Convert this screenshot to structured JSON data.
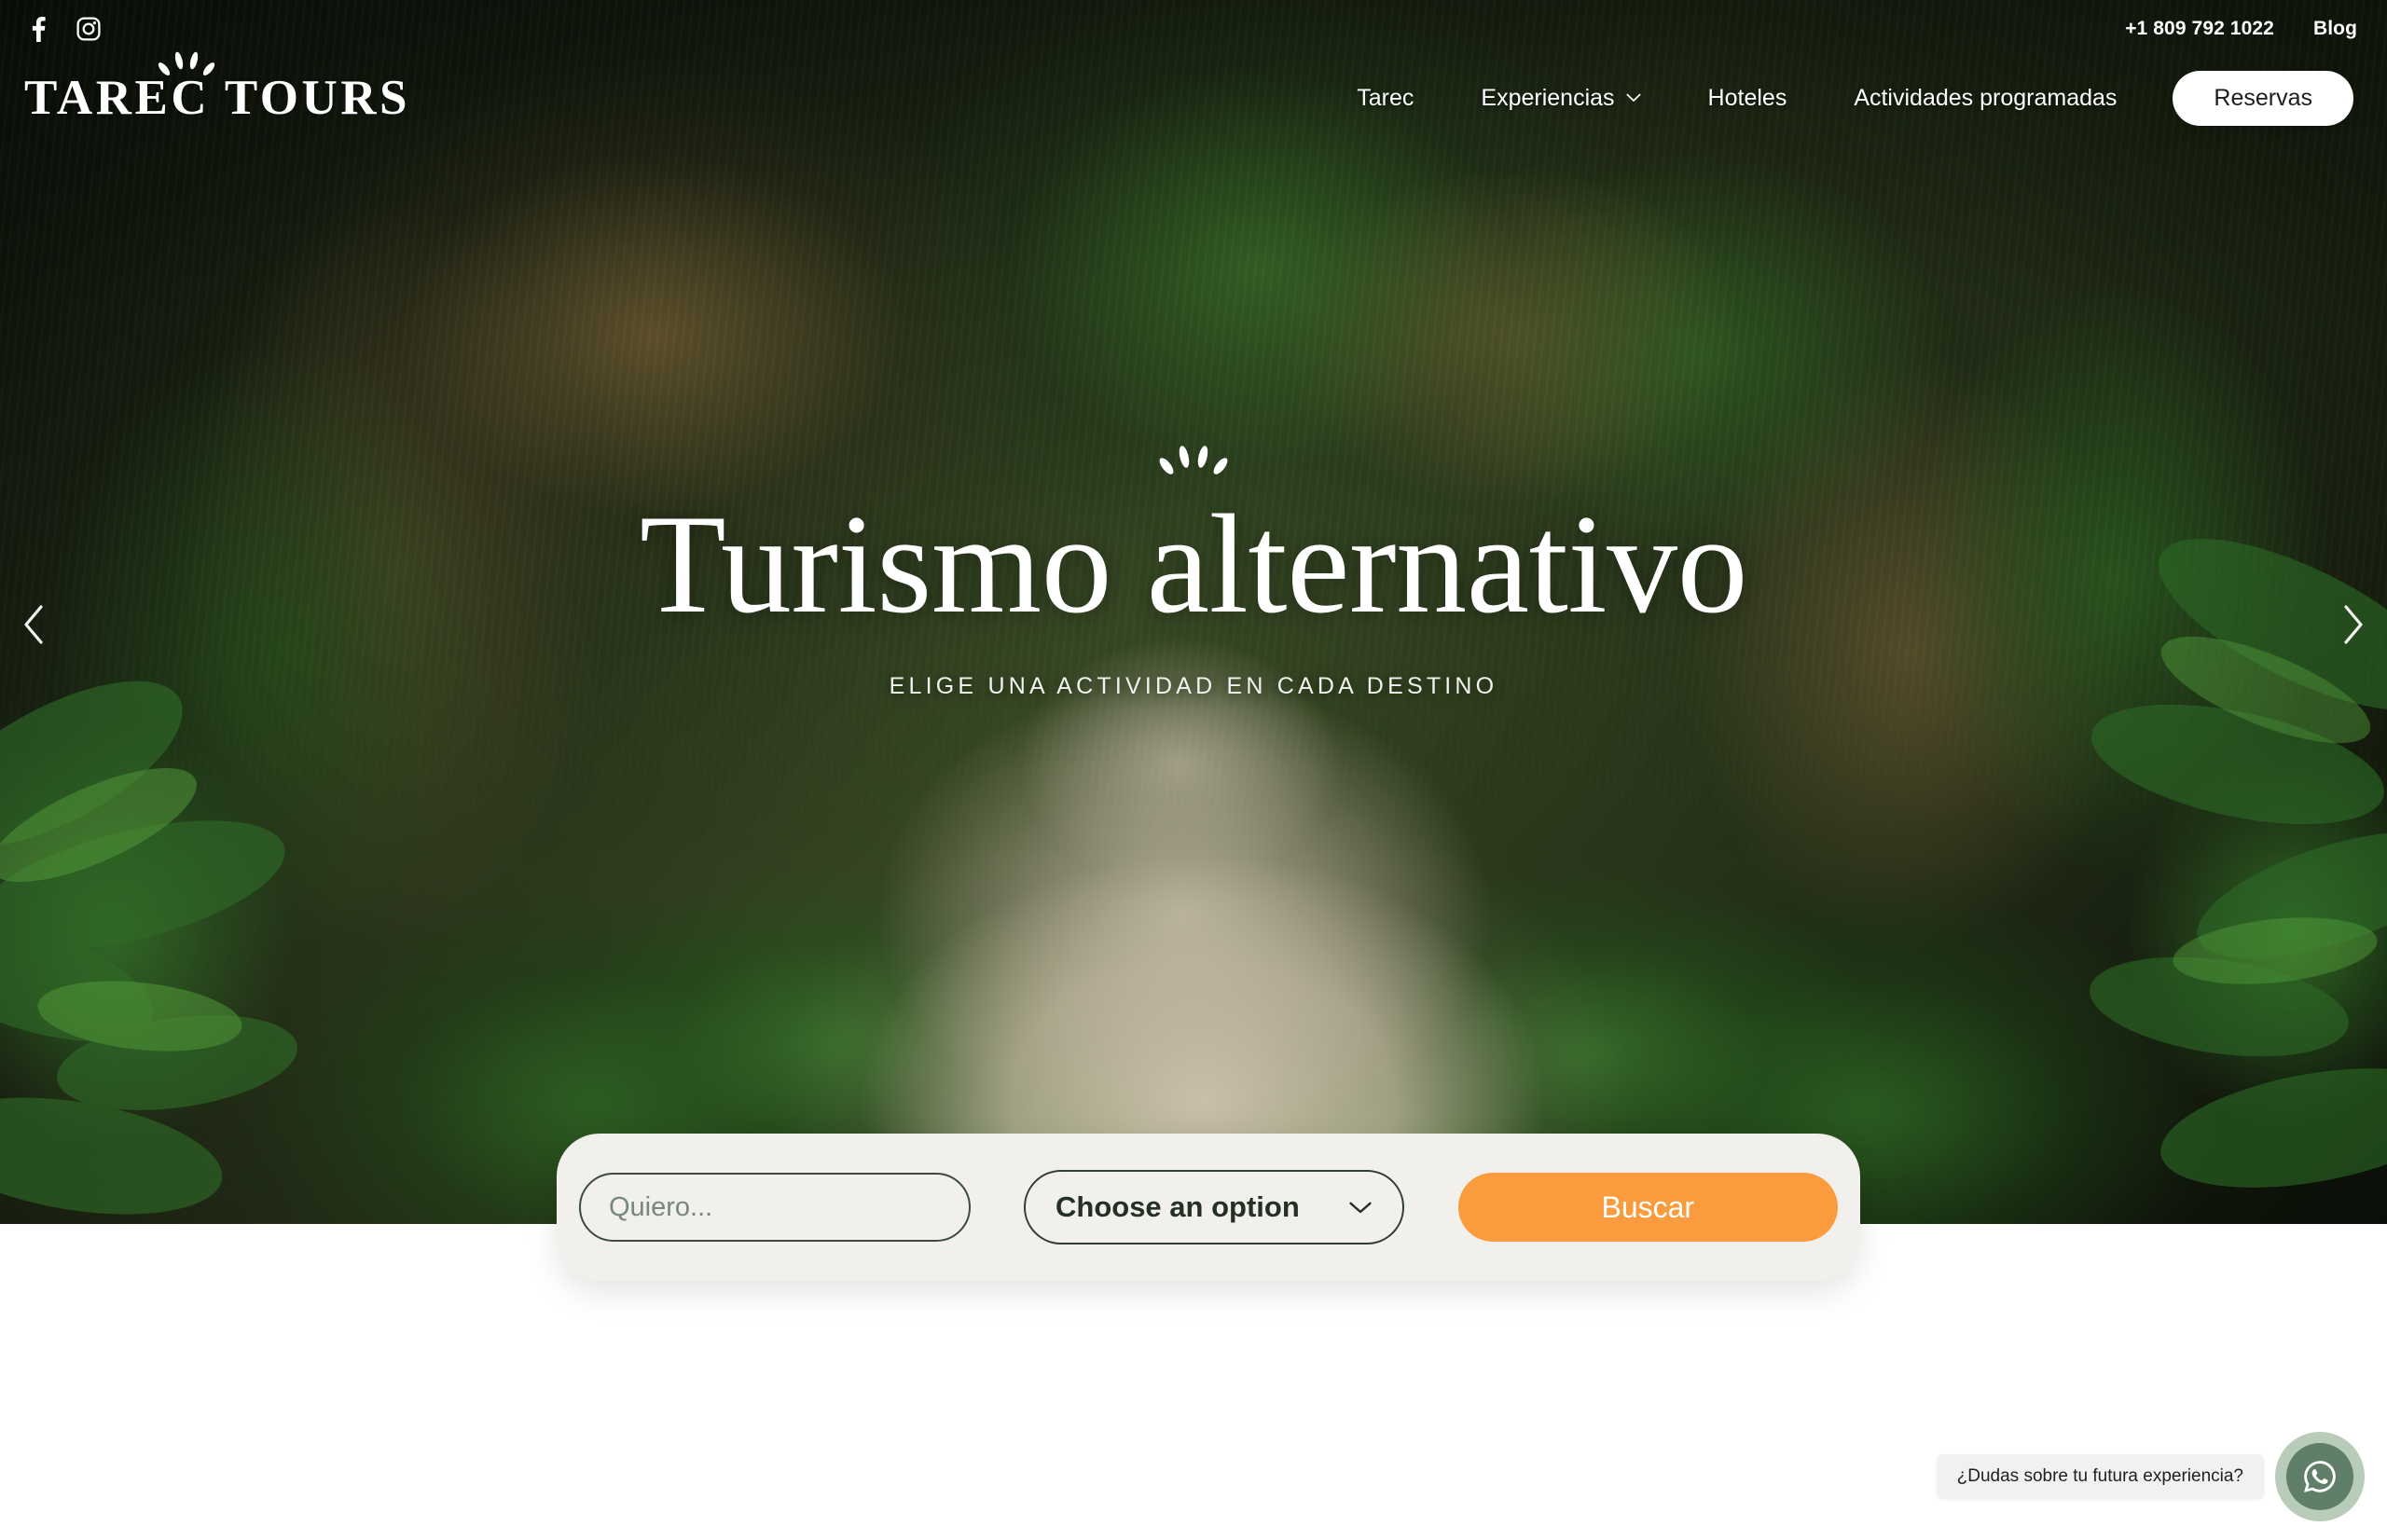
{
  "brand": {
    "logo_text": "TAREC TOURS",
    "accent_orange": "#FA9B3D",
    "panel_cream": "#F2F0EC",
    "select_green": "#2F3D33",
    "whatsapp_green": "#5F7F68"
  },
  "topbar": {
    "social": [
      {
        "name": "facebook-icon",
        "label": "Facebook"
      },
      {
        "name": "instagram-icon",
        "label": "Instagram"
      }
    ],
    "phone": "+1 809 792 1022",
    "blog_label": "Blog"
  },
  "nav": {
    "items": [
      {
        "label": "Tarec",
        "has_dropdown": false
      },
      {
        "label": "Experiencias",
        "has_dropdown": true
      },
      {
        "label": "Hoteles",
        "has_dropdown": false
      },
      {
        "label": "Actividades programadas",
        "has_dropdown": false
      }
    ],
    "cta_label": "Reservas"
  },
  "carousel": {
    "prev_icon": "chevron-left-icon",
    "next_icon": "chevron-right-icon"
  },
  "hero": {
    "decoration": "sunburst-icon",
    "title": "Turismo alternativo",
    "subtitle": "ELIGE UNA ACTIVIDAD EN CADA DESTINO"
  },
  "search": {
    "input_placeholder": "Quiero...",
    "input_value": "",
    "select_value": "Choose an option",
    "select_icon": "chevron-down-icon",
    "submit_label": "Buscar"
  },
  "whatsapp": {
    "tooltip": "¿Dudas sobre tu futura experiencia?",
    "icon": "whatsapp-icon"
  }
}
